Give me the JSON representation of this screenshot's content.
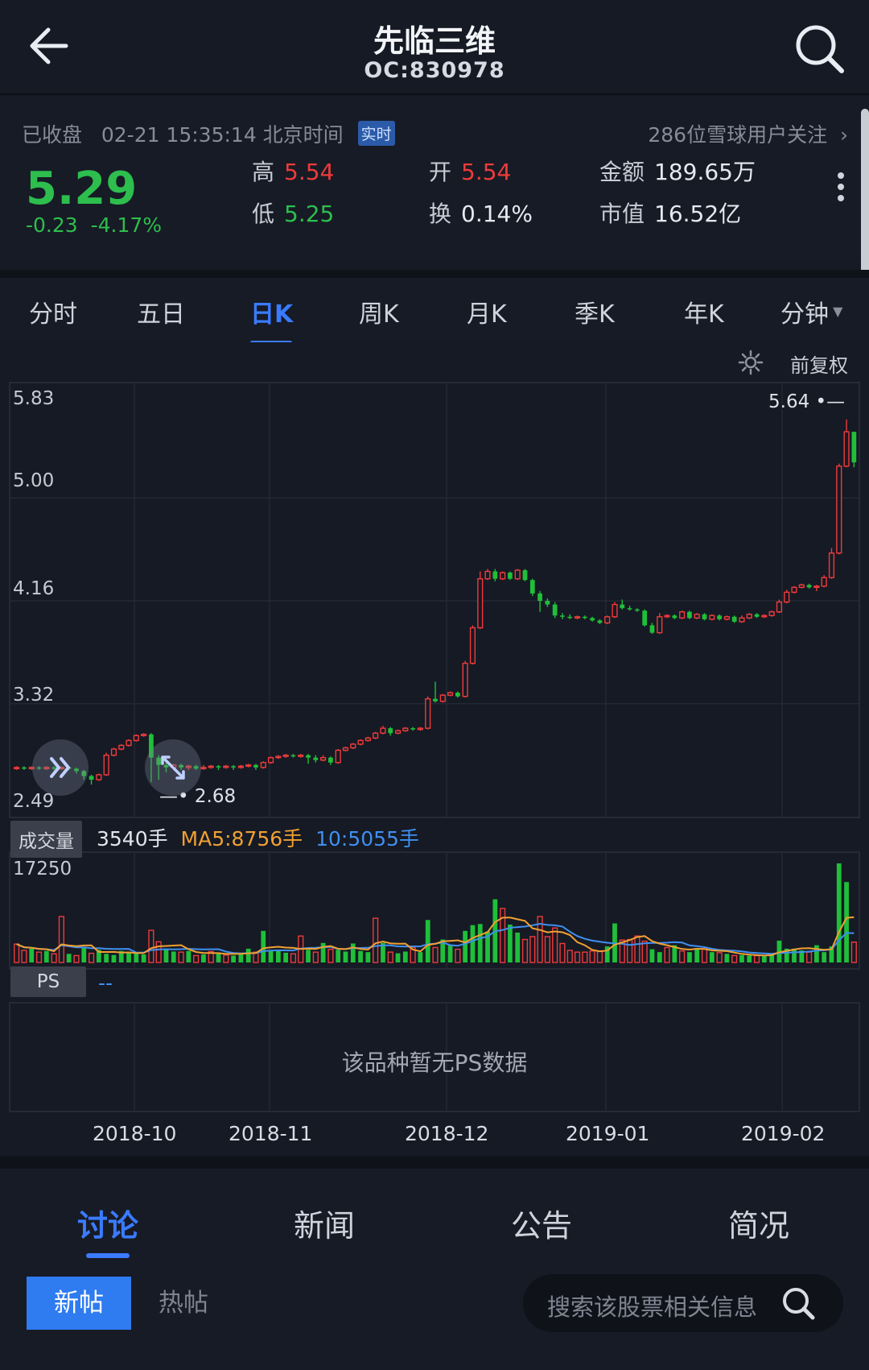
{
  "header": {
    "title": "先临三维",
    "code": "OC:830978"
  },
  "quote": {
    "status": "已收盘",
    "time": "02-21 15:35:14 北京时间",
    "realtime_badge": "实时",
    "followers": "286位雪球用户关注",
    "price": "5.29",
    "change": "-0.23",
    "change_pct": "-4.17%",
    "high_label": "高",
    "high": "5.54",
    "low_label": "低",
    "low": "5.25",
    "open_label": "开",
    "open": "5.54",
    "turnover_label": "换",
    "turnover": "0.14%",
    "amount_label": "金额",
    "amount": "189.65万",
    "mktcap_label": "市值",
    "mktcap": "16.52亿"
  },
  "tabs": [
    "分时",
    "五日",
    "日K",
    "周K",
    "月K",
    "季K",
    "年K",
    "分钟"
  ],
  "active_tab": "日K",
  "adjust_label": "前复权",
  "chart": {
    "y_ticks": [
      "5.83",
      "5.00",
      "4.16",
      "3.32",
      "2.49"
    ],
    "max_label": "5.64",
    "min_label": "2.68",
    "volume_label": "成交量",
    "volume_value": "3540手",
    "ma5": "MA5:8756手",
    "ma10": "10:5055手",
    "volume_top": "17250",
    "ps_label": "PS",
    "ps_value": "--",
    "ps_empty": "该品种暂无PS数据",
    "x_labels": [
      "2018-10",
      "2018-11",
      "2018-12",
      "2019-01",
      "2019-02"
    ]
  },
  "chart_data": {
    "type": "candlestick",
    "ylim": [
      2.49,
      5.83
    ],
    "candles": [
      [
        2.79,
        2.8,
        2.81,
        2.78
      ],
      [
        2.8,
        2.79,
        2.81,
        2.78
      ],
      [
        2.79,
        2.8,
        2.81,
        2.78
      ],
      [
        2.8,
        2.79,
        2.81,
        2.78
      ],
      [
        2.79,
        2.8,
        2.81,
        2.78
      ],
      [
        2.8,
        2.79,
        2.81,
        2.78
      ],
      [
        2.79,
        2.8,
        2.81,
        2.78
      ],
      [
        2.8,
        2.79,
        2.81,
        2.78
      ],
      [
        2.79,
        2.77,
        2.8,
        2.75
      ],
      [
        2.77,
        2.73,
        2.78,
        2.7
      ],
      [
        2.73,
        2.7,
        2.74,
        2.66
      ],
      [
        2.7,
        2.74,
        2.75,
        2.69
      ],
      [
        2.74,
        2.9,
        2.92,
        2.73
      ],
      [
        2.9,
        2.95,
        2.96,
        2.89
      ],
      [
        2.95,
        2.98,
        2.99,
        2.94
      ],
      [
        2.98,
        3.02,
        3.03,
        2.97
      ],
      [
        3.02,
        3.06,
        3.07,
        3.01
      ],
      [
        3.06,
        3.07,
        3.08,
        3.05
      ],
      [
        3.07,
        2.88,
        3.08,
        2.68
      ],
      [
        2.88,
        2.82,
        2.9,
        2.7
      ],
      [
        2.82,
        2.8,
        2.84,
        2.76
      ],
      [
        2.8,
        2.82,
        2.83,
        2.78
      ],
      [
        2.82,
        2.8,
        2.83,
        2.78
      ],
      [
        2.8,
        2.81,
        2.82,
        2.78
      ],
      [
        2.81,
        2.79,
        2.82,
        2.78
      ],
      [
        2.79,
        2.8,
        2.82,
        2.78
      ],
      [
        2.8,
        2.81,
        2.82,
        2.79
      ],
      [
        2.81,
        2.8,
        2.82,
        2.78
      ],
      [
        2.8,
        2.81,
        2.82,
        2.79
      ],
      [
        2.81,
        2.8,
        2.82,
        2.78
      ],
      [
        2.8,
        2.81,
        2.82,
        2.79
      ],
      [
        2.81,
        2.82,
        2.83,
        2.8
      ],
      [
        2.82,
        2.8,
        2.83,
        2.78
      ],
      [
        2.8,
        2.84,
        2.85,
        2.79
      ],
      [
        2.84,
        2.88,
        2.89,
        2.83
      ],
      [
        2.88,
        2.89,
        2.9,
        2.87
      ],
      [
        2.89,
        2.9,
        2.91,
        2.88
      ],
      [
        2.9,
        2.89,
        2.91,
        2.88
      ],
      [
        2.89,
        2.9,
        2.91,
        2.88
      ],
      [
        2.9,
        2.88,
        2.91,
        2.83
      ],
      [
        2.88,
        2.86,
        2.9,
        2.84
      ],
      [
        2.86,
        2.88,
        2.9,
        2.85
      ],
      [
        2.88,
        2.84,
        2.89,
        2.82
      ],
      [
        2.84,
        2.94,
        2.95,
        2.83
      ],
      [
        2.94,
        2.96,
        2.97,
        2.93
      ],
      [
        2.96,
        2.99,
        3.0,
        2.95
      ],
      [
        2.99,
        3.02,
        3.03,
        2.98
      ],
      [
        3.02,
        3.04,
        3.05,
        3.01
      ],
      [
        3.04,
        3.08,
        3.09,
        3.03
      ],
      [
        3.08,
        3.12,
        3.14,
        3.07
      ],
      [
        3.12,
        3.08,
        3.13,
        3.06
      ],
      [
        3.08,
        3.1,
        3.11,
        3.07
      ],
      [
        3.1,
        3.12,
        3.13,
        3.09
      ],
      [
        3.12,
        3.11,
        3.13,
        3.1
      ],
      [
        3.11,
        3.12,
        3.13,
        3.1
      ],
      [
        3.12,
        3.36,
        3.38,
        3.11
      ],
      [
        3.36,
        3.34,
        3.5,
        3.33
      ],
      [
        3.34,
        3.39,
        3.4,
        3.33
      ],
      [
        3.39,
        3.41,
        3.42,
        3.38
      ],
      [
        3.41,
        3.38,
        3.42,
        3.37
      ],
      [
        3.38,
        3.65,
        3.67,
        3.37
      ],
      [
        3.65,
        3.94,
        3.96,
        3.64
      ],
      [
        3.94,
        4.34,
        4.4,
        3.93
      ],
      [
        4.34,
        4.4,
        4.42,
        4.33
      ],
      [
        4.4,
        4.34,
        4.42,
        4.32
      ],
      [
        4.34,
        4.39,
        4.4,
        4.33
      ],
      [
        4.39,
        4.34,
        4.4,
        4.33
      ],
      [
        4.34,
        4.41,
        4.42,
        4.33
      ],
      [
        4.41,
        4.33,
        4.42,
        4.32
      ],
      [
        4.33,
        4.22,
        4.34,
        4.2
      ],
      [
        4.22,
        4.16,
        4.24,
        4.07
      ],
      [
        4.16,
        4.13,
        4.18,
        4.11
      ],
      [
        4.13,
        4.04,
        4.15,
        4.02
      ],
      [
        4.04,
        4.03,
        4.06,
        4.01
      ],
      [
        4.03,
        4.02,
        4.05,
        4.01
      ],
      [
        4.02,
        4.03,
        4.04,
        4.01
      ],
      [
        4.03,
        4.02,
        4.04,
        4.01
      ],
      [
        4.02,
        4.0,
        4.03,
        3.99
      ],
      [
        4.0,
        3.98,
        4.01,
        3.97
      ],
      [
        3.98,
        4.03,
        4.04,
        3.97
      ],
      [
        4.03,
        4.13,
        4.15,
        4.02
      ],
      [
        4.13,
        4.1,
        4.17,
        4.09
      ],
      [
        4.1,
        4.09,
        4.12,
        4.08
      ],
      [
        4.09,
        4.08,
        4.1,
        4.07
      ],
      [
        4.08,
        3.96,
        4.09,
        3.95
      ],
      [
        3.96,
        3.9,
        3.98,
        3.89
      ],
      [
        3.9,
        4.03,
        4.06,
        3.89
      ],
      [
        4.03,
        4.04,
        4.05,
        4.02
      ],
      [
        4.04,
        4.02,
        4.05,
        4.01
      ],
      [
        4.02,
        4.07,
        4.08,
        4.01
      ],
      [
        4.07,
        4.02,
        4.08,
        4.01
      ],
      [
        4.02,
        4.05,
        4.06,
        4.01
      ],
      [
        4.05,
        4.01,
        4.06,
        4.0
      ],
      [
        4.01,
        4.04,
        4.05,
        4.0
      ],
      [
        4.04,
        4.01,
        4.05,
        4.0
      ],
      [
        4.01,
        4.03,
        4.04,
        4.0
      ],
      [
        4.03,
        3.99,
        4.04,
        3.98
      ],
      [
        3.99,
        4.02,
        4.04,
        3.98
      ],
      [
        4.02,
        4.05,
        4.06,
        4.01
      ],
      [
        4.05,
        4.03,
        4.06,
        4.02
      ],
      [
        4.03,
        4.04,
        4.05,
        4.02
      ],
      [
        4.04,
        4.07,
        4.08,
        4.03
      ],
      [
        4.07,
        4.15,
        4.17,
        4.06
      ],
      [
        4.15,
        4.23,
        4.25,
        4.14
      ],
      [
        4.23,
        4.27,
        4.28,
        4.22
      ],
      [
        4.27,
        4.29,
        4.3,
        4.26
      ],
      [
        4.29,
        4.27,
        4.3,
        4.26
      ],
      [
        4.27,
        4.28,
        4.29,
        4.24
      ],
      [
        4.28,
        4.35,
        4.37,
        4.27
      ],
      [
        4.35,
        4.55,
        4.59,
        4.34
      ],
      [
        4.55,
        5.26,
        5.28,
        4.54
      ],
      [
        5.26,
        5.54,
        5.64,
        5.25
      ],
      [
        5.54,
        5.29,
        5.54,
        5.25
      ]
    ],
    "volume": [
      [
        3200,
        0
      ],
      [
        2100,
        0
      ],
      [
        2400,
        1
      ],
      [
        1800,
        0
      ],
      [
        2000,
        1
      ],
      [
        1500,
        0
      ],
      [
        8000,
        0
      ],
      [
        1500,
        1
      ],
      [
        1200,
        0
      ],
      [
        2600,
        1
      ],
      [
        1600,
        0
      ],
      [
        2200,
        1
      ],
      [
        1500,
        1
      ],
      [
        1300,
        1
      ],
      [
        2000,
        1
      ],
      [
        1800,
        1
      ],
      [
        1600,
        1
      ],
      [
        1400,
        1
      ],
      [
        5600,
        0
      ],
      [
        3600,
        0
      ],
      [
        2200,
        1
      ],
      [
        1900,
        1
      ],
      [
        1800,
        0
      ],
      [
        2000,
        1
      ],
      [
        1200,
        0
      ],
      [
        1400,
        1
      ],
      [
        1900,
        0
      ],
      [
        1600,
        1
      ],
      [
        1300,
        0
      ],
      [
        1200,
        1
      ],
      [
        1500,
        1
      ],
      [
        2400,
        1
      ],
      [
        1800,
        0
      ],
      [
        5500,
        1
      ],
      [
        2000,
        1
      ],
      [
        2000,
        1
      ],
      [
        1700,
        1
      ],
      [
        1500,
        0
      ],
      [
        4600,
        0
      ],
      [
        2200,
        1
      ],
      [
        1800,
        0
      ],
      [
        3400,
        1
      ],
      [
        2300,
        0
      ],
      [
        2200,
        1
      ],
      [
        1900,
        1
      ],
      [
        3300,
        1
      ],
      [
        2000,
        1
      ],
      [
        1800,
        1
      ],
      [
        7700,
        0
      ],
      [
        3400,
        1
      ],
      [
        1800,
        0
      ],
      [
        1600,
        1
      ],
      [
        1900,
        1
      ],
      [
        2600,
        0
      ],
      [
        1800,
        1
      ],
      [
        7400,
        1
      ],
      [
        2600,
        0
      ],
      [
        4000,
        1
      ],
      [
        3000,
        1
      ],
      [
        2300,
        0
      ],
      [
        5500,
        1
      ],
      [
        6500,
        1
      ],
      [
        6700,
        1
      ],
      [
        5400,
        1
      ],
      [
        11000,
        1
      ],
      [
        9400,
        0
      ],
      [
        6600,
        1
      ],
      [
        5200,
        1
      ],
      [
        4000,
        0
      ],
      [
        4500,
        0
      ],
      [
        8000,
        0
      ],
      [
        4500,
        0
      ],
      [
        6000,
        0
      ],
      [
        3300,
        0
      ],
      [
        2100,
        0
      ],
      [
        1800,
        0
      ],
      [
        1800,
        0
      ],
      [
        2000,
        0
      ],
      [
        2000,
        0
      ],
      [
        2800,
        1
      ],
      [
        6800,
        1
      ],
      [
        3900,
        0
      ],
      [
        4000,
        0
      ],
      [
        4600,
        0
      ],
      [
        3700,
        0
      ],
      [
        2300,
        1
      ],
      [
        1800,
        1
      ],
      [
        2600,
        0
      ],
      [
        3000,
        1
      ],
      [
        2000,
        0
      ],
      [
        1800,
        1
      ],
      [
        2500,
        1
      ],
      [
        2400,
        0
      ],
      [
        1800,
        1
      ],
      [
        1700,
        0
      ],
      [
        1500,
        1
      ],
      [
        1200,
        0
      ],
      [
        1300,
        1
      ],
      [
        1200,
        1
      ],
      [
        1200,
        0
      ],
      [
        1100,
        1
      ],
      [
        1600,
        1
      ],
      [
        3800,
        1
      ],
      [
        2400,
        1
      ],
      [
        2400,
        1
      ],
      [
        2100,
        1
      ],
      [
        1800,
        0
      ],
      [
        3000,
        1
      ],
      [
        1800,
        1
      ],
      [
        2800,
        1
      ],
      [
        17250,
        1
      ],
      [
        14000,
        1
      ],
      [
        3540,
        0
      ]
    ]
  },
  "bottom_tabs": [
    "讨论",
    "新闻",
    "公告",
    "简况"
  ],
  "post": {
    "new": "新帖",
    "hot": "热帖",
    "search_placeholder": "搜索该股票相关信息"
  }
}
